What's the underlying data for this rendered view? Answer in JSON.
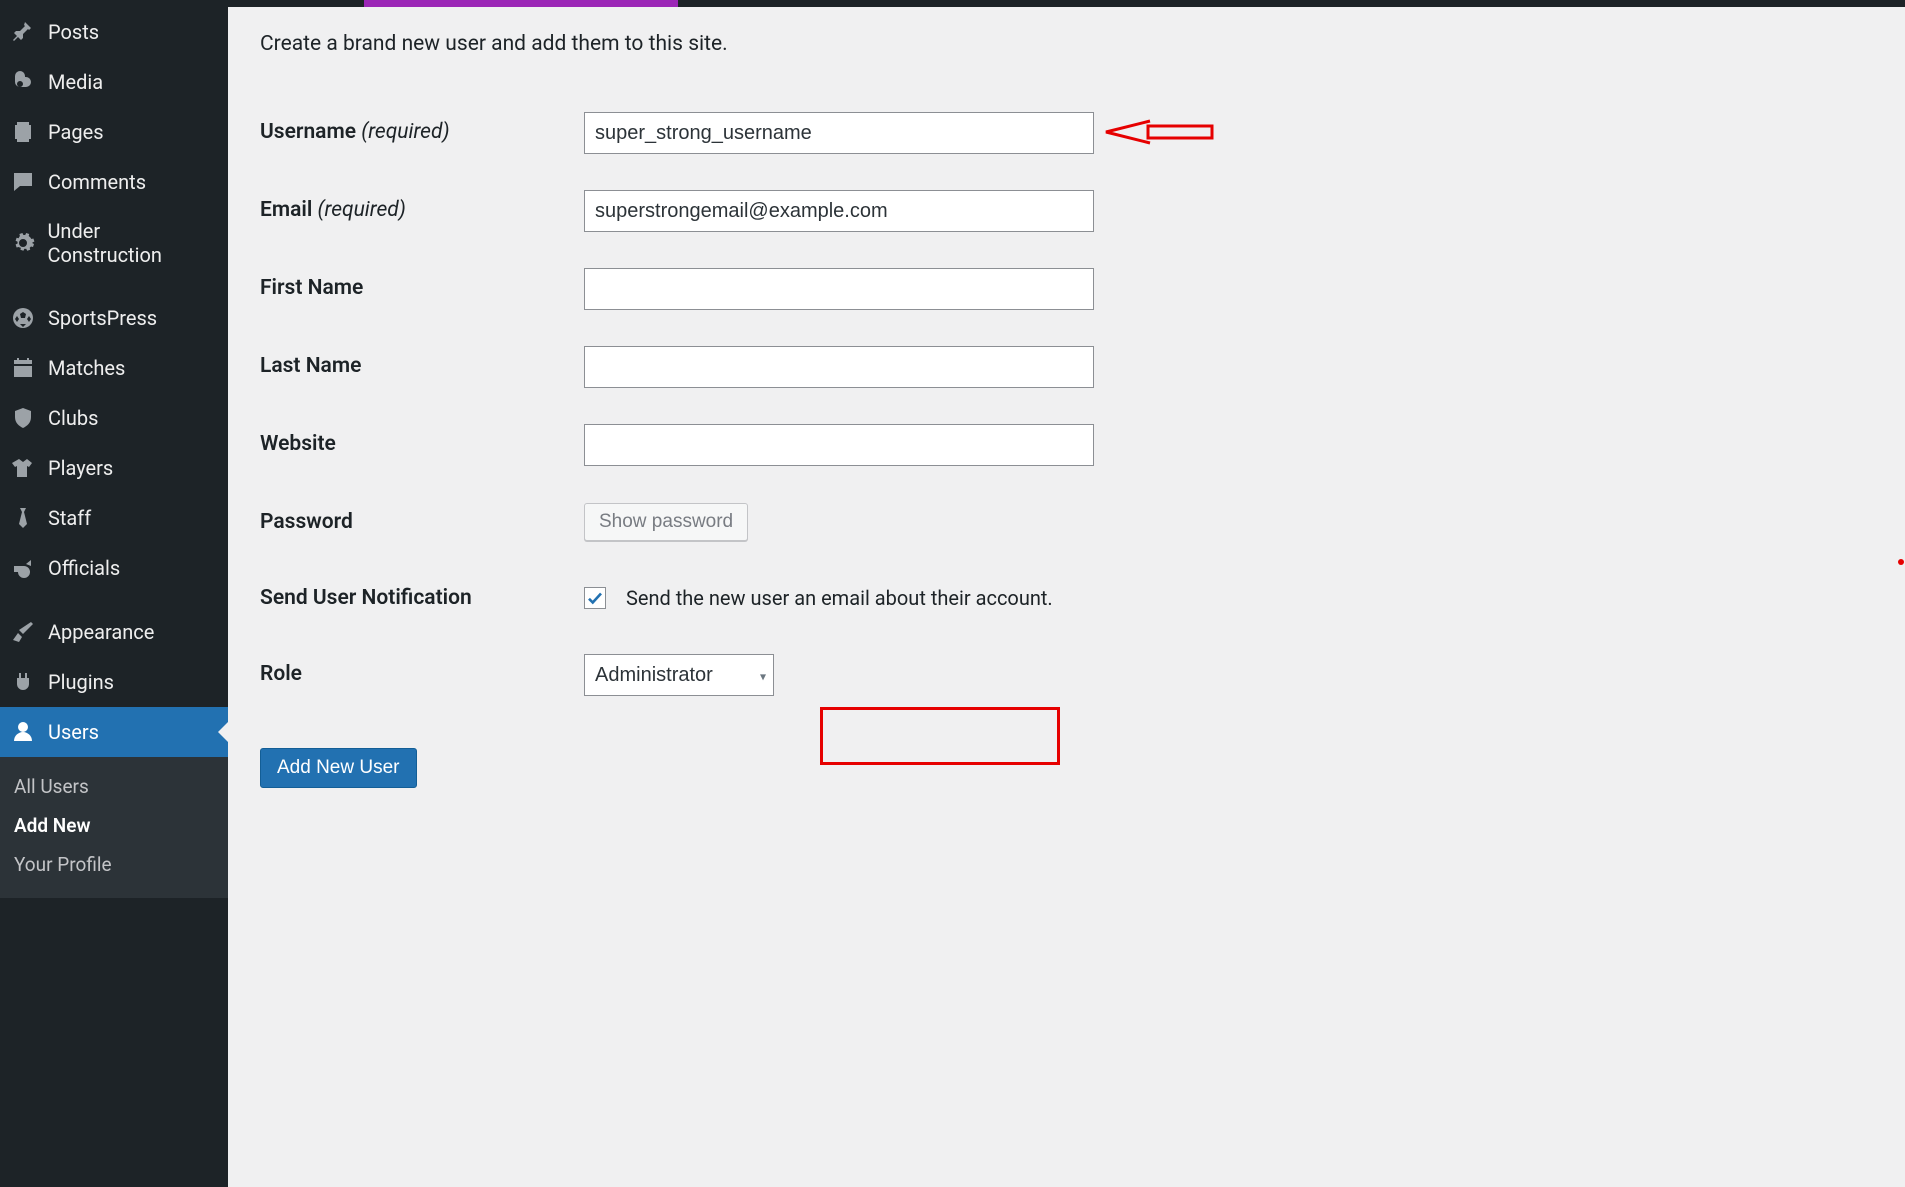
{
  "sidebar": {
    "items": [
      {
        "label": "Posts",
        "icon": "pin"
      },
      {
        "label": "Media",
        "icon": "media"
      },
      {
        "label": "Pages",
        "icon": "page"
      },
      {
        "label": "Comments",
        "icon": "comment"
      },
      {
        "label": "Under Construction",
        "icon": "gear"
      },
      {
        "label": "SportsPress",
        "icon": "soccer"
      },
      {
        "label": "Matches",
        "icon": "calendar"
      },
      {
        "label": "Clubs",
        "icon": "shield"
      },
      {
        "label": "Players",
        "icon": "shirt"
      },
      {
        "label": "Staff",
        "icon": "tie"
      },
      {
        "label": "Officials",
        "icon": "whistle"
      },
      {
        "label": "Appearance",
        "icon": "brush"
      },
      {
        "label": "Plugins",
        "icon": "plug"
      },
      {
        "label": "Users",
        "icon": "user",
        "current": true
      }
    ],
    "submenu": [
      {
        "label": "All Users"
      },
      {
        "label": "Add New",
        "current": true
      },
      {
        "label": "Your Profile"
      }
    ]
  },
  "intro": "Create a brand new user and add them to this site.",
  "form": {
    "username": {
      "label": "Username",
      "required_text": "(required)",
      "value": "super_strong_username"
    },
    "email": {
      "label": "Email",
      "required_text": "(required)",
      "value": "superstrongemail@example.com"
    },
    "first_name": {
      "label": "First Name",
      "value": ""
    },
    "last_name": {
      "label": "Last Name",
      "value": ""
    },
    "website": {
      "label": "Website",
      "value": ""
    },
    "password": {
      "label": "Password",
      "show_button": "Show password"
    },
    "notification": {
      "label": "Send User Notification",
      "checkbox_label": "Send the new user an email about their account.",
      "checked": true
    },
    "role": {
      "label": "Role",
      "value": "Administrator"
    },
    "submit": "Add New User"
  }
}
